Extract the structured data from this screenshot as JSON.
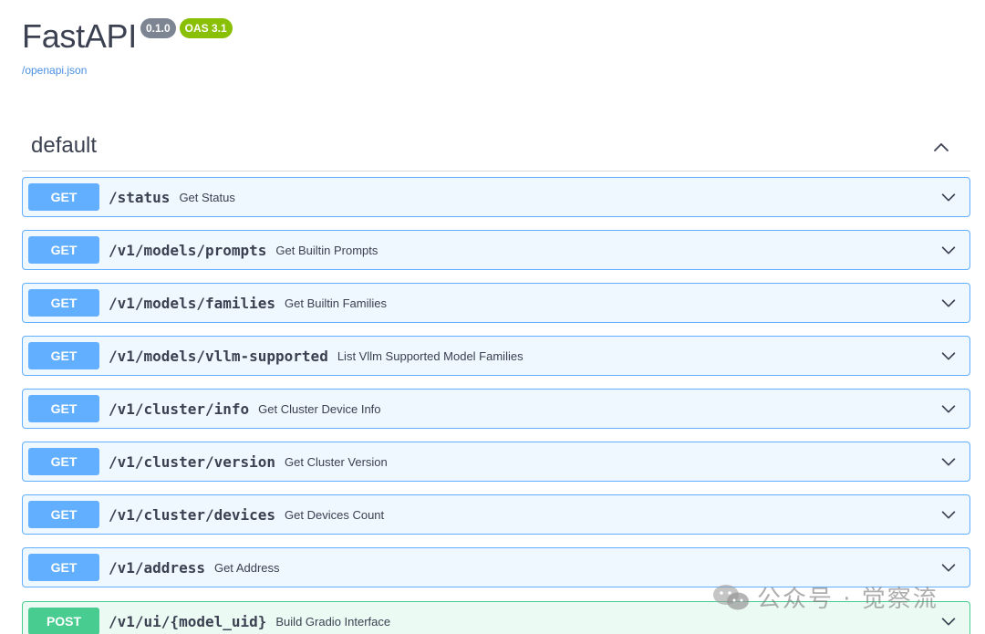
{
  "header": {
    "title": "FastAPI",
    "version_badge": "0.1.0",
    "oas_badge": "OAS 3.1",
    "openapi_link": "/openapi.json"
  },
  "section": {
    "title": "default",
    "collapse_icon": "chevron-up-icon"
  },
  "operations": [
    {
      "method": "GET",
      "path": "/status",
      "summary": "Get Status"
    },
    {
      "method": "GET",
      "path": "/v1/models/prompts",
      "summary": "Get Builtin Prompts"
    },
    {
      "method": "GET",
      "path": "/v1/models/families",
      "summary": "Get Builtin Families"
    },
    {
      "method": "GET",
      "path": "/v1/models/vllm-supported",
      "summary": "List Vllm Supported Model Families"
    },
    {
      "method": "GET",
      "path": "/v1/cluster/info",
      "summary": "Get Cluster Device Info"
    },
    {
      "method": "GET",
      "path": "/v1/cluster/version",
      "summary": "Get Cluster Version"
    },
    {
      "method": "GET",
      "path": "/v1/cluster/devices",
      "summary": "Get Devices Count"
    },
    {
      "method": "GET",
      "path": "/v1/address",
      "summary": "Get Address"
    },
    {
      "method": "POST",
      "path": "/v1/ui/{model_uid}",
      "summary": "Build Gradio Interface"
    }
  ],
  "colors": {
    "get": "#61affe",
    "post": "#49cc90",
    "version_badge": "#7d8492",
    "oas_badge": "#89bf04",
    "link": "#4990e2"
  },
  "watermark": {
    "text": "公众号 · 觉察流",
    "icon": "wechat-icon"
  }
}
